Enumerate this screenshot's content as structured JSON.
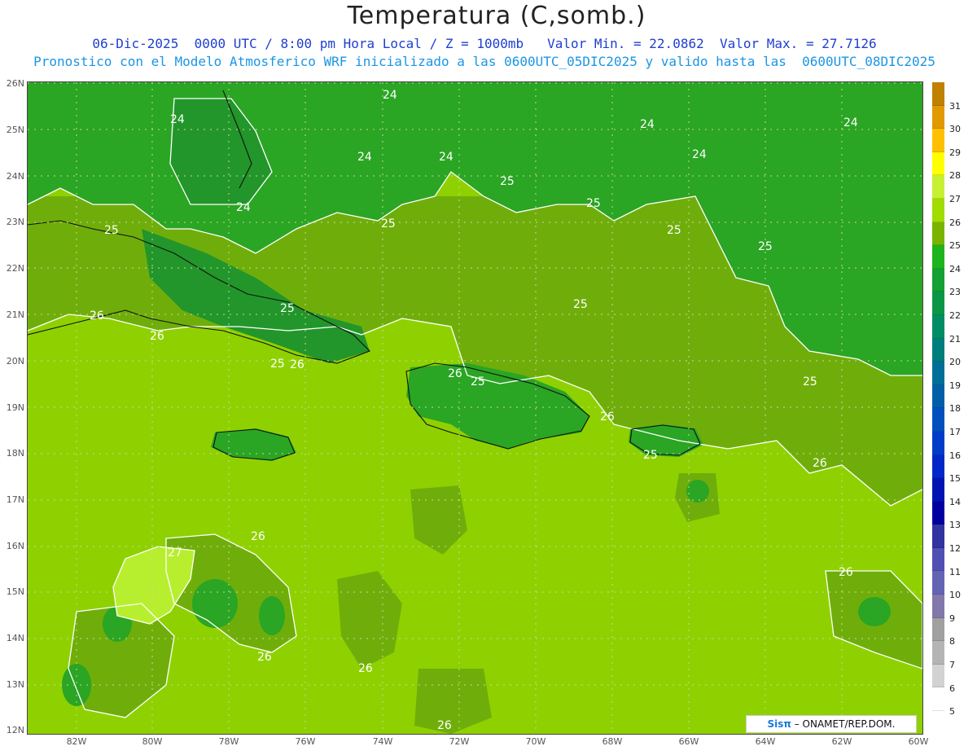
{
  "title": "Temperatura (C,somb.)",
  "subtitle1": "06-Dic-2025  0000 UTC / 8:00 pm Hora Local / Z = 1000mb   Valor Min. = 22.0862  Valor Max. = 27.7126",
  "subtitle2": "Pronostico con el Modelo Atmosferico WRF inicializado a las 0600UTC_05DIC2025 y valido hasta las  0600UTC_08DIC2025",
  "lat_labels": [
    "26N",
    "25N",
    "24N",
    "23N",
    "22N",
    "21N",
    "20N",
    "19N",
    "18N",
    "17N",
    "16N",
    "15N",
    "14N",
    "13N",
    "12N"
  ],
  "lon_labels": [
    "82W",
    "80W",
    "78W",
    "76W",
    "74W",
    "72W",
    "70W",
    "68W",
    "66W",
    "64W",
    "62W",
    "60W"
  ],
  "colorbar": {
    "labels": [
      "31",
      "30",
      "29",
      "28",
      "27",
      "26",
      "25",
      "24",
      "23",
      "22",
      "21",
      "20",
      "19",
      "18",
      "17",
      "16",
      "15",
      "14",
      "13",
      "12",
      "11",
      "10",
      "9",
      "8",
      "7",
      "6",
      "5"
    ],
    "colors": [
      "#c08000",
      "#e09a00",
      "#ffc000",
      "#ffff00",
      "#c8f032",
      "#a0dc00",
      "#78b400",
      "#1eb41e",
      "#14a032",
      "#0a9646",
      "#008c64",
      "#007d7d",
      "#006e96",
      "#005fa8",
      "#0050be",
      "#003cc8",
      "#0028c8",
      "#0014b4",
      "#0000a0",
      "#3232a0",
      "#5050b4",
      "#6464b4",
      "#8278aa",
      "#a0a0a0",
      "#b4b4b4",
      "#d2d2d2",
      "#ffffff"
    ]
  },
  "contour_labels": [
    "24",
    "24",
    "24",
    "24",
    "24",
    "24",
    "24",
    "24",
    "25",
    "25",
    "25",
    "25",
    "25",
    "25",
    "25",
    "25",
    "25",
    "25",
    "25",
    "25",
    "26",
    "26",
    "26",
    "26",
    "26",
    "26",
    "26",
    "26",
    "26",
    "26",
    "26",
    "27"
  ],
  "credit": {
    "brand": "Sisπ",
    "text": " – ONAMET/REP.DOM."
  }
}
